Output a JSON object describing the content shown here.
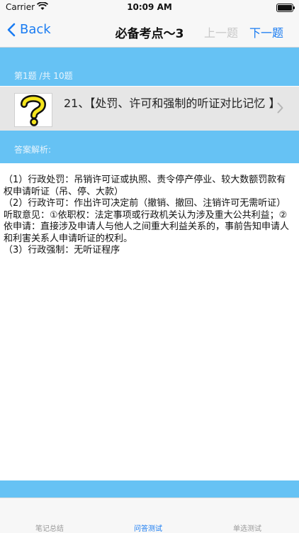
{
  "status": {
    "carrier": "Carrier",
    "time": "10:09 AM"
  },
  "nav": {
    "back_label": "Back",
    "title": "必备考点～3",
    "prev_label": "上一题",
    "next_label": "下一题"
  },
  "progress": "第1题 /共 10题",
  "question": {
    "title": "21、【处罚、许可和强制的听证对比记忆 】"
  },
  "analysis_label": "答案解析:",
  "answer": [
    "（1）行政处罚：吊销许可证或执照、责令停产停业、较大数额罚款有权申请听证（吊、停、大款）",
    "（2）行政许可：作出许可决定前（撤销、撤回、注销许可无需听证）听取意见：①依职权：法定事项或行政机关认为涉及重大公共利益；②依申请：直接涉及申请人与他人之间重大利益关系的，事前告知申请人和利害关系人申请听证的权利。",
    "（3）行政强制：无听证程序"
  ],
  "tabs": [
    {
      "label": "笔记总结",
      "active": false
    },
    {
      "label": "问答测试",
      "active": true
    },
    {
      "label": "单选测试",
      "active": false
    }
  ],
  "colors": {
    "accent": "#1a7cf2",
    "band": "#66c2f4"
  }
}
